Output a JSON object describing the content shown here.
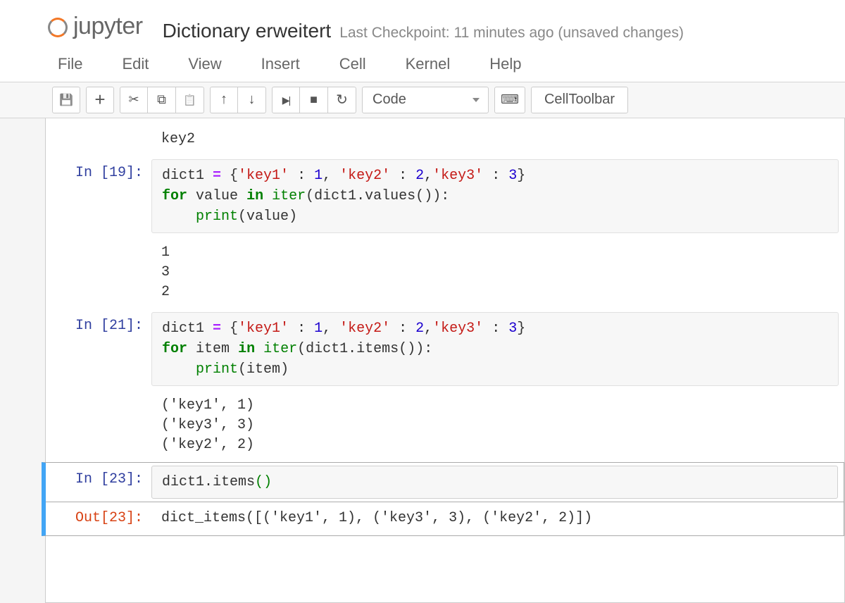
{
  "header": {
    "logo_text": "jupyter",
    "notebook_title": "Dictionary erweitert",
    "checkpoint_text": "Last Checkpoint: 11 minutes ago (unsaved changes)"
  },
  "menu": {
    "file": "File",
    "edit": "Edit",
    "view": "View",
    "insert": "Insert",
    "cell": "Cell",
    "kernel": "Kernel",
    "help": "Help"
  },
  "toolbar": {
    "celltype_selected": "Code",
    "celltoolbar_label": "CellToolbar"
  },
  "cells": {
    "top_trailing_output": "key2",
    "c19_prompt": "In [19]:",
    "c19_output": "1\n3\n2",
    "c21_prompt": "In [21]:",
    "c21_output": "('key1', 1)\n('key3', 3)\n('key2', 2)",
    "c23_in_prompt": "In [23]:",
    "c23_out_prompt": "Out[23]:",
    "c23_output": "dict_items([('key1', 1), ('key3', 3), ('key2', 2)])"
  },
  "code_tokens": {
    "dict1": "dict1",
    "eq": " = ",
    "lb": "{",
    "rb": "}",
    "lp": "(",
    "rp": ")",
    "colon_sp": " : ",
    "comma": ", ",
    "comma_ns": ",",
    "key1": "'key1'",
    "key2": "'key2'",
    "key3": "'key3'",
    "n1": "1",
    "n2": "2",
    "n3": "3",
    "for": "for",
    "in": "in",
    "value": "value",
    "item": "item",
    "iter": "iter",
    "print": "print",
    "values": "values",
    "items": "items",
    "dot": ".",
    "colon": ":",
    "indent": "    ",
    "sp": " "
  }
}
